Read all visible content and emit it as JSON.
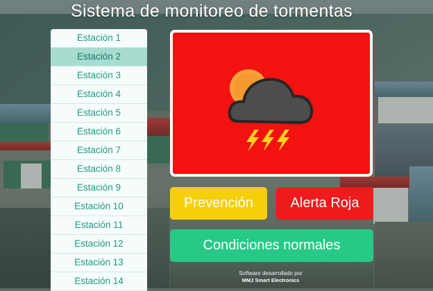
{
  "header": {
    "title": "Sistema de monitoreo de tormentas"
  },
  "stations": {
    "selected_index": 1,
    "items": [
      "Estación 1",
      "Estación 2",
      "Estación 3",
      "Estación 4",
      "Estación 5",
      "Estación 6",
      "Estación 7",
      "Estación 8",
      "Estación 9",
      "Estación 10",
      "Estación 11",
      "Estación 12",
      "Estación 13",
      "Estación 14"
    ]
  },
  "status_panel": {
    "icon": "storm-cloud-lightning-icon",
    "background_color": "#f2120f"
  },
  "actions": {
    "prevention_label": "Prevención",
    "red_alert_label": "Alerta Roja",
    "normal_label": "Condiciones normales"
  },
  "colors": {
    "prevention": "#f6cf0b",
    "red_alert": "#ef1a1b",
    "normal": "#27c986",
    "station_text": "#1d9b84",
    "station_selected": "#a9dcd0"
  },
  "footer": {
    "credit_line1": "Software desarrollado por",
    "credit_line2": "MMJ Smart Electronics"
  }
}
